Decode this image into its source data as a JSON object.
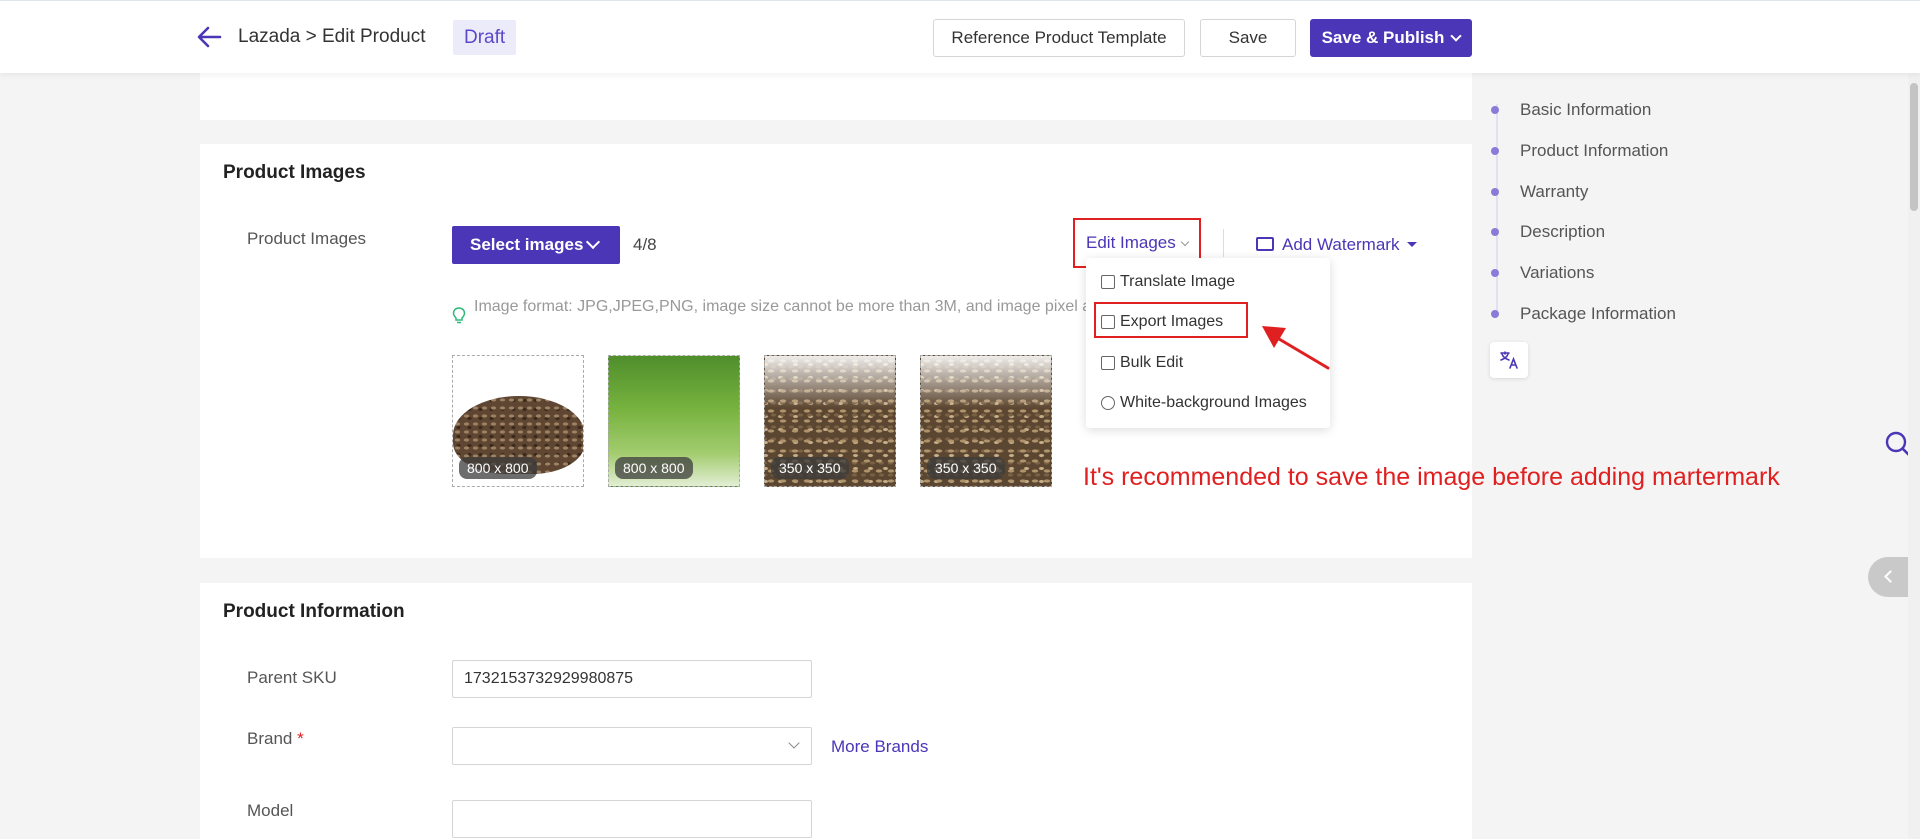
{
  "header": {
    "breadcrumb": "Lazada > Edit Product",
    "status": "Draft",
    "buttons": {
      "template": "Reference Product Template",
      "save": "Save",
      "publish": "Save & Publish"
    }
  },
  "images_section": {
    "title": "Product Images",
    "field_label": "Product Images",
    "select_label": "Select images",
    "count": "4/8",
    "edit_label": "Edit Images",
    "watermark_label": "Add Watermark",
    "hint": "Image format: JPG,JPEG,PNG, image size cannot be more than 3M, and image pixel and 5000x5000px",
    "images": [
      {
        "size": "800 x 800"
      },
      {
        "size": "800 x 800"
      },
      {
        "size": "350 x 350"
      },
      {
        "size": "350 x 350"
      }
    ],
    "menu": [
      {
        "label": "Translate Image"
      },
      {
        "label": "Export Images"
      },
      {
        "label": "Bulk Edit"
      },
      {
        "label": "White-background Images"
      }
    ]
  },
  "annotation": {
    "note": "It's recommended to save the image before adding martermark",
    "color": "#e02020"
  },
  "info_section": {
    "title": "Product Information",
    "parent_sku_label": "Parent SKU",
    "parent_sku_value": "1732153732929980875",
    "brand_label": "Brand",
    "brand_required": "*",
    "more_brands": "More Brands",
    "model_label": "Model"
  },
  "nav": {
    "items": [
      {
        "label": "Basic Information"
      },
      {
        "label": "Product Information"
      },
      {
        "label": "Warranty"
      },
      {
        "label": "Description"
      },
      {
        "label": "Variations"
      },
      {
        "label": "Package Information"
      }
    ],
    "translate_icon": "translate-icon"
  },
  "theme": {
    "accent": "#4a36b6"
  }
}
